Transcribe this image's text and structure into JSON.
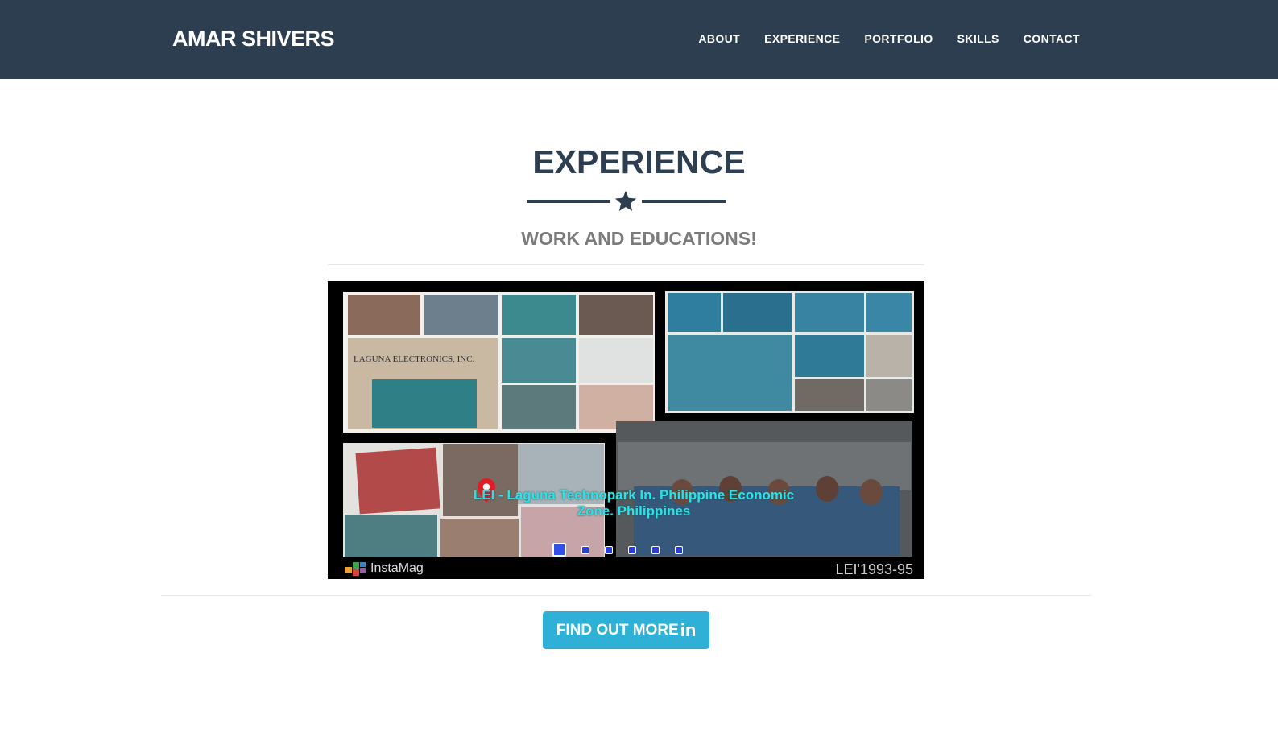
{
  "navbar": {
    "brand": "AMAR SHIVERS",
    "links": [
      "ABOUT",
      "EXPERIENCE",
      "PORTFOLIO",
      "SKILLS",
      "CONTACT"
    ]
  },
  "section": {
    "title": "EXPERIENCE",
    "divider_icon": "star-icon",
    "subtitle": "WORK AND EDUCATIONS!"
  },
  "carousel": {
    "caption": "LEI - Laguna Technopark In. Philippine Economic Zone. Philippines",
    "collage_sign": "LAGUNA ELECTRONICS, INC.",
    "watermark": "InstaMag",
    "stamp": "LEI'1993-95",
    "slide_count": 6,
    "active_slide": 1,
    "caption_color": "#2fe0e6"
  },
  "cta": {
    "label": "FIND OUT MORE",
    "icon": "in",
    "color": "#2fb0d6"
  },
  "colors": {
    "navbar": "#2c3e50",
    "title": "#2c3e50",
    "subtitle": "#7b7b7b"
  }
}
